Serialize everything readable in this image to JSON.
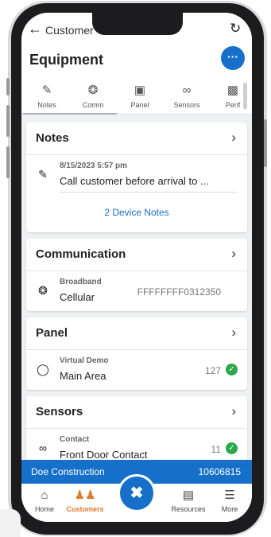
{
  "header": {
    "back_label": "Customer",
    "title": "Equipment",
    "more_icon": "ellipsis-icon"
  },
  "tabs": [
    {
      "label": "Notes",
      "icon": "edit-icon"
    },
    {
      "label": "Comm",
      "icon": "antenna-icon"
    },
    {
      "label": "Panel",
      "icon": "panel-icon"
    },
    {
      "label": "Sensors",
      "icon": "link-icon"
    },
    {
      "label": "Perif",
      "icon": "peripheral-icon"
    }
  ],
  "notes": {
    "title": "Notes",
    "item": {
      "date": "8/15/2023 5:57 pm",
      "text": "Call customer before arrival to ..."
    },
    "link": "2 Device Notes"
  },
  "communication": {
    "title": "Communication",
    "item": {
      "type": "Broadband",
      "name": "Cellular",
      "value": "FFFFFFFF0312350"
    }
  },
  "panel": {
    "title": "Panel",
    "item": {
      "type": "Virtual Demo",
      "name": "Main Area",
      "value": "127"
    }
  },
  "sensors": {
    "title": "Sensors",
    "item": {
      "type": "Contact",
      "name": "Front Door Contact",
      "value": "11"
    }
  },
  "customer_bar": {
    "name": "Doe Construction",
    "number": "10606815"
  },
  "bottom_nav": {
    "home": "Home",
    "customers": "Customers",
    "resources": "Resources",
    "more": "More"
  },
  "colors": {
    "accent": "#1670c9",
    "ok": "#2aa84a",
    "active_nav": "#e07a2a"
  }
}
